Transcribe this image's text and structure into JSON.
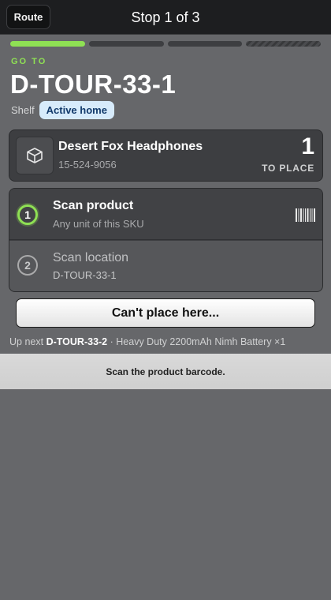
{
  "header": {
    "route_label": "Route",
    "title": "Stop 1 of 3"
  },
  "progress": {
    "segments": [
      "done",
      "todo",
      "todo",
      "pending"
    ]
  },
  "destination": {
    "goto_label": "GO TO",
    "location": "D-TOUR-33-1",
    "shelf_label": "Shelf",
    "badge": "Active home"
  },
  "product": {
    "icon": "box-icon",
    "name": "Desert Fox Headphones",
    "sku": "15-524-9056",
    "quantity": "1",
    "quantity_label": "TO PLACE"
  },
  "steps": [
    {
      "number": "1",
      "title": "Scan product",
      "subtitle": "Any unit of this SKU",
      "status": "active",
      "icon": "barcode-icon"
    },
    {
      "number": "2",
      "title": "Scan location",
      "subtitle": "D-TOUR-33-1",
      "status": "pending"
    }
  ],
  "actions": {
    "cant_place_label": "Can't place here..."
  },
  "up_next": {
    "prefix": "Up next",
    "location": "D-TOUR-33-2",
    "details": "· Heavy Duty 2200mAh Nimh Battery ×1"
  },
  "hint": "Scan the product barcode.",
  "colors": {
    "accent": "#8fe054",
    "badge_bg": "#d7ebfb",
    "badge_text": "#123a6b",
    "background": "#66676a",
    "topbar": "#1d1e20"
  }
}
